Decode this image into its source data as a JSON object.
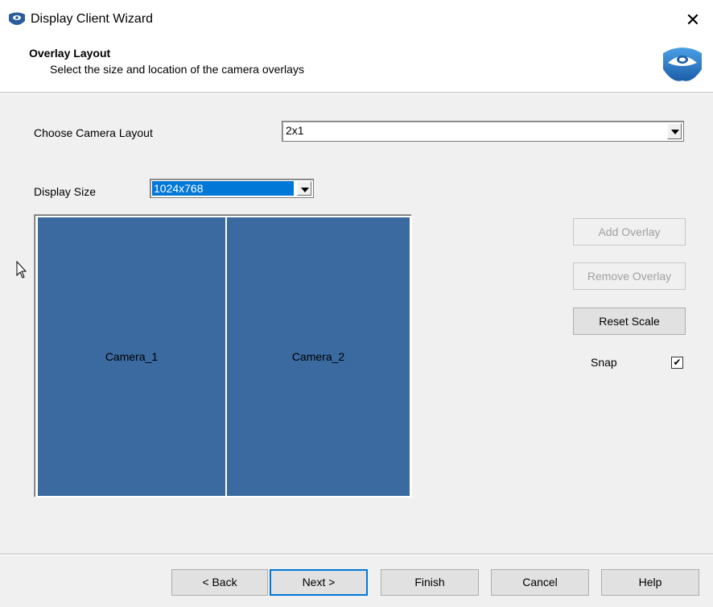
{
  "window": {
    "title": "Display Client Wizard",
    "close_glyph": "✕",
    "app_icon": "mask-icon"
  },
  "header": {
    "title": "Overlay Layout",
    "subtitle": "Select the size and location of the camera overlays",
    "brand_icon": "mask-icon"
  },
  "form": {
    "camera_layout_label": "Choose Camera Layout",
    "camera_layout_value": "2x1",
    "display_size_label": "Display Size",
    "display_size_value": "1024x768"
  },
  "preview": {
    "cameras": [
      "Camera_1",
      "Camera_2"
    ],
    "camera_color": "#3a6aa0"
  },
  "side_buttons": {
    "add_overlay": "Add Overlay",
    "remove_overlay": "Remove Overlay",
    "reset_scale": "Reset Scale"
  },
  "snap": {
    "label": "Snap",
    "checked": true,
    "check_glyph": "✔"
  },
  "footer": {
    "back": "< Back",
    "next": "Next >",
    "finish": "Finish",
    "cancel": "Cancel",
    "help": "Help"
  }
}
